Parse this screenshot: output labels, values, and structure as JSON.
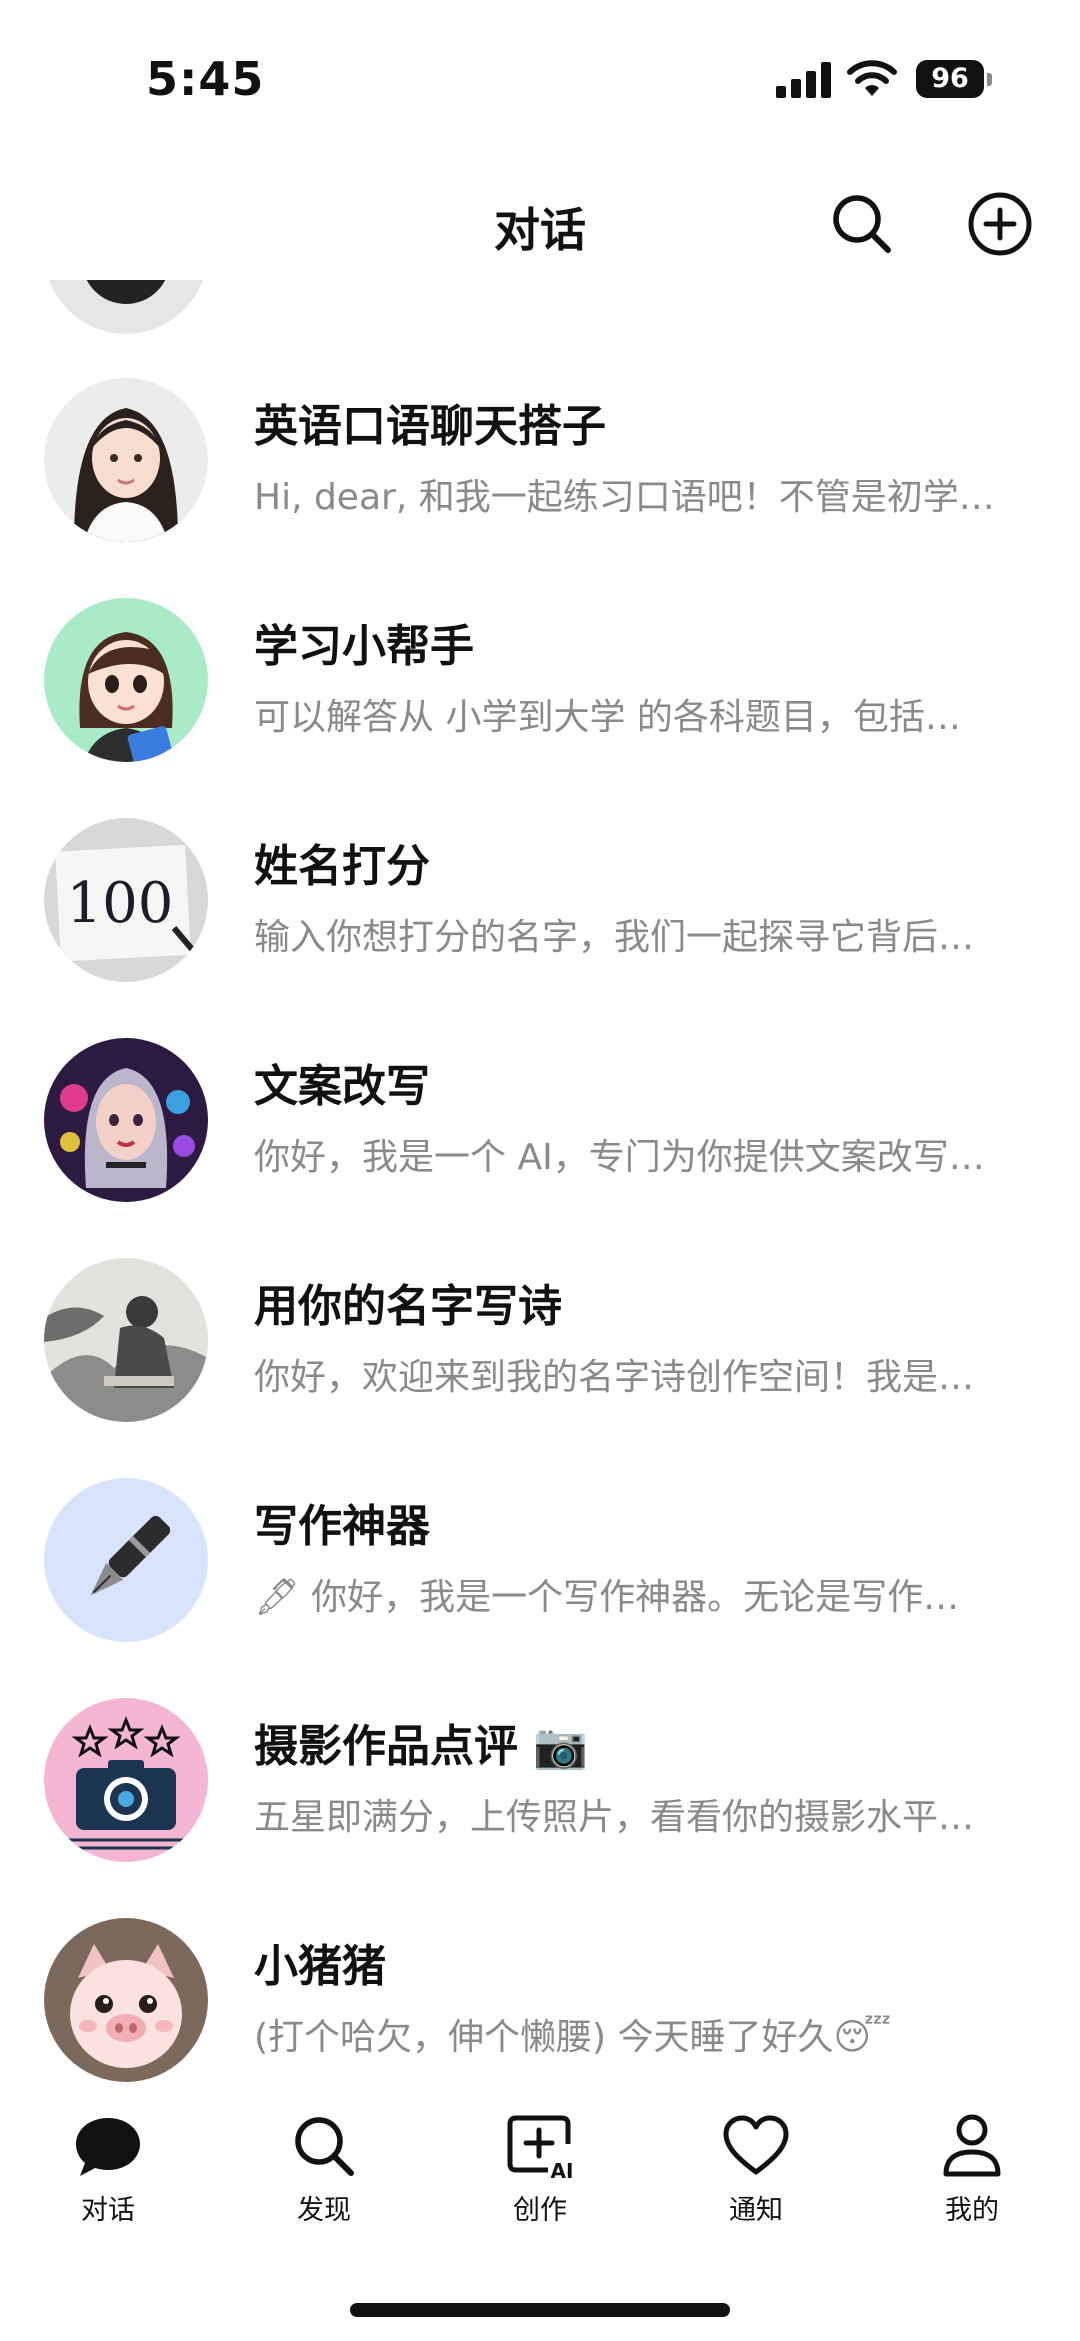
{
  "status_bar": {
    "time": "5:45",
    "battery": "96"
  },
  "header": {
    "title": "对话"
  },
  "chats": [
    {
      "name": "英语口语聊天搭子",
      "preview": "Hi, dear, 和我一起练习口语吧！不管是初学…"
    },
    {
      "name": "学习小帮手",
      "preview": "可以解答从 小学到大学 的各科题目，包括…"
    },
    {
      "name": "姓名打分",
      "preview": "输入你想打分的名字，我们一起探寻它背后…"
    },
    {
      "name": "文案改写",
      "preview": "你好，我是一个 AI，专门为你提供文案改写…"
    },
    {
      "name": "用你的名字写诗",
      "preview": "你好，欢迎来到我的名字诗创作空间！我是…"
    },
    {
      "name": "写作神器",
      "preview": "🖋 你好，我是一个写作神器。无论是写作…"
    },
    {
      "name": "摄影作品点评 📷",
      "preview": "五星即满分，上传照片，看看你的摄影水平…"
    },
    {
      "name": "小猪猪",
      "preview": "(打个哈欠，伸个懒腰) 今天睡了好久😴"
    }
  ],
  "avatars": {
    "score_text": "100"
  },
  "tabs": [
    {
      "label": "对话",
      "icon": "chat-bubble-icon",
      "active": true
    },
    {
      "label": "发现",
      "icon": "search-icon"
    },
    {
      "label": "创作",
      "icon": "ai-create-icon"
    },
    {
      "label": "通知",
      "icon": "heart-icon"
    },
    {
      "label": "我的",
      "icon": "person-icon"
    }
  ]
}
